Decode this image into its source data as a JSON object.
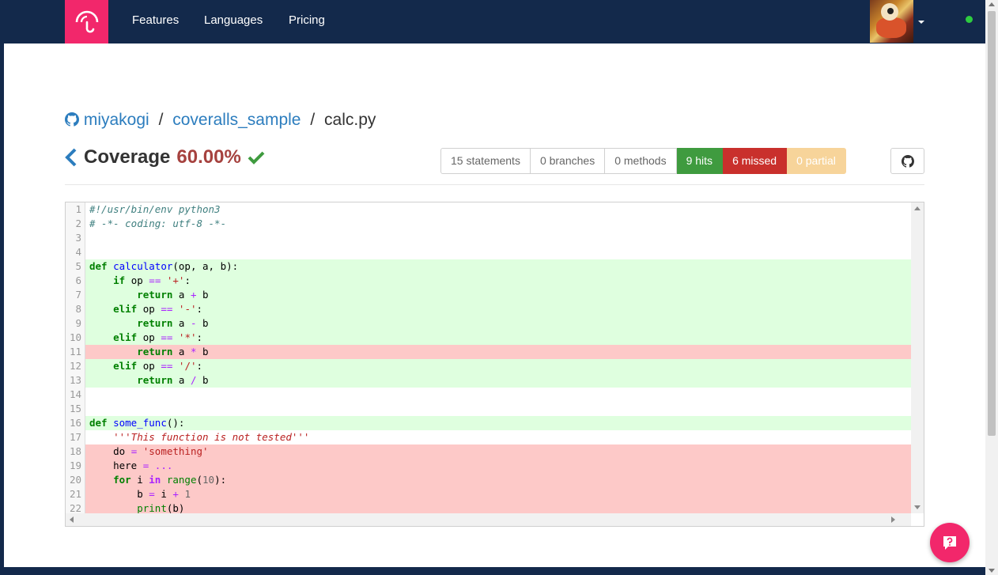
{
  "nav": {
    "links": [
      "Features",
      "Languages",
      "Pricing"
    ],
    "status_color": "#2ecc40"
  },
  "breadcrumb": {
    "owner": "miyakogi",
    "separator": "/",
    "repo": "coveralls_sample",
    "file": "calc.py"
  },
  "coverage": {
    "label": "Coverage",
    "percent": "60.00%"
  },
  "stats": {
    "statements": "15 statements",
    "branches": "0 branches",
    "methods": "0 methods",
    "hits": "9 hits",
    "missed": "6 missed",
    "partial": "0 partial"
  },
  "colors": {
    "navbar": "#13294b",
    "brand": "#f2276b",
    "hit_bg": "#dfffdf",
    "miss_bg": "#fdc9c8",
    "percent": "#a6423f",
    "hits_badge": "#3f9b3f",
    "missed_badge": "#c9302c",
    "partial_badge": "#f7d49a"
  },
  "code_lines": [
    {
      "n": "1",
      "status": "none",
      "text": "#!/usr/bin/env python3"
    },
    {
      "n": "2",
      "status": "none",
      "text": "# -*- coding: utf-8 -*-"
    },
    {
      "n": "3",
      "status": "none",
      "text": ""
    },
    {
      "n": "4",
      "status": "none",
      "text": ""
    },
    {
      "n": "5",
      "status": "hit",
      "text": "def calculator(op, a, b):"
    },
    {
      "n": "6",
      "status": "hit",
      "text": "    if op == '+':"
    },
    {
      "n": "7",
      "status": "hit",
      "text": "        return a + b"
    },
    {
      "n": "8",
      "status": "hit",
      "text": "    elif op == '-':"
    },
    {
      "n": "9",
      "status": "hit",
      "text": "        return a - b"
    },
    {
      "n": "10",
      "status": "hit",
      "text": "    elif op == '*':"
    },
    {
      "n": "11",
      "status": "miss",
      "text": "        return a * b"
    },
    {
      "n": "12",
      "status": "hit",
      "text": "    elif op == '/':"
    },
    {
      "n": "13",
      "status": "hit",
      "text": "        return a / b"
    },
    {
      "n": "14",
      "status": "none",
      "text": ""
    },
    {
      "n": "15",
      "status": "none",
      "text": ""
    },
    {
      "n": "16",
      "status": "hit",
      "text": "def some_func():"
    },
    {
      "n": "17",
      "status": "none",
      "text": "    '''This function is not tested'''"
    },
    {
      "n": "18",
      "status": "miss",
      "text": "    do = 'something'"
    },
    {
      "n": "19",
      "status": "miss",
      "text": "    here = ..."
    },
    {
      "n": "20",
      "status": "miss",
      "text": "    for i in range(10):"
    },
    {
      "n": "21",
      "status": "miss",
      "text": "        b = i + 1"
    },
    {
      "n": "22",
      "status": "miss",
      "text": "        print(b)"
    }
  ]
}
